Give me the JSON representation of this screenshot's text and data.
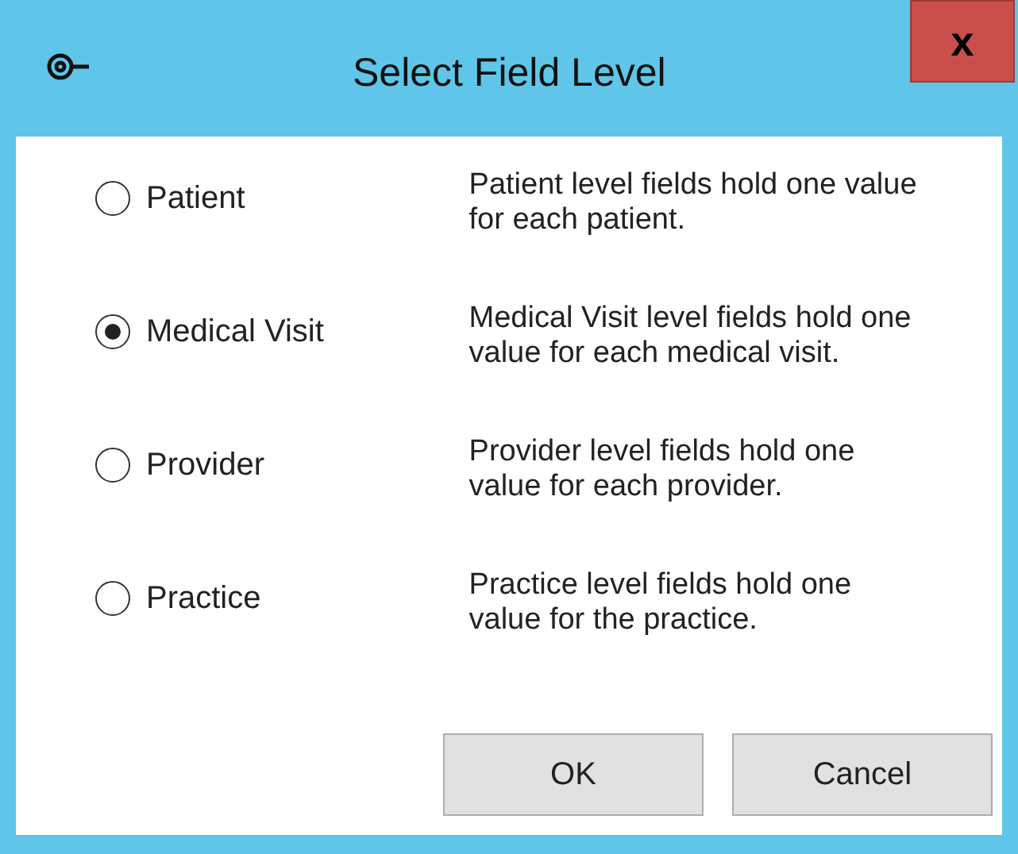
{
  "window": {
    "title": "Select Field Level",
    "close": "x"
  },
  "options": [
    {
      "label": "Patient",
      "selected": false,
      "description": "Patient level fields hold one value for each patient."
    },
    {
      "label": "Medical Visit",
      "selected": true,
      "description": "Medical Visit level fields hold one value for each medical visit."
    },
    {
      "label": "Provider",
      "selected": false,
      "description": "Provider level fields hold one value for each provider."
    },
    {
      "label": "Practice",
      "selected": false,
      "description": "Practice level fields hold one value for the practice."
    }
  ],
  "buttons": [
    "OK",
    "Cancel"
  ]
}
